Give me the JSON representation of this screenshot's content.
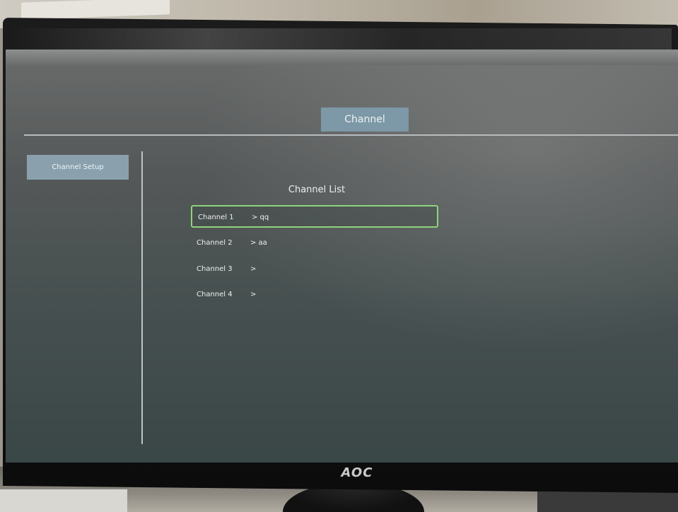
{
  "app": {
    "header_title": "Channel",
    "brand": "AOC"
  },
  "sidebar": {
    "items": [
      {
        "label": "Channel Setup",
        "selected": true
      }
    ]
  },
  "main": {
    "list_title": "Channel List",
    "channels": [
      {
        "name": "Channel 1",
        "value": "> qq",
        "selected": true
      },
      {
        "name": "Channel 2",
        "value": "> aa",
        "selected": false
      },
      {
        "name": "Channel 3",
        "value": ">",
        "selected": false
      },
      {
        "name": "Channel 4",
        "value": ">",
        "selected": false
      }
    ]
  },
  "colors": {
    "selection_border": "#8fd37c",
    "tab_background": "#7d98a6",
    "sidebar_selected_background": "#8aa1ad"
  }
}
